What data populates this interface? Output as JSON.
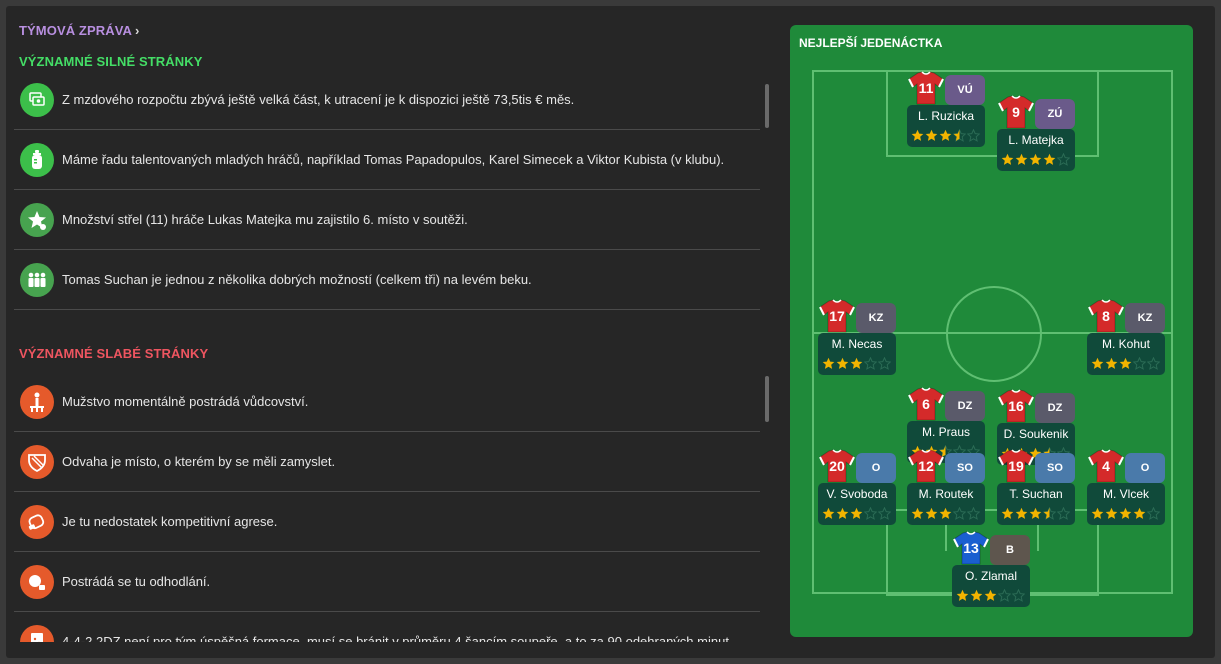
{
  "report": {
    "title": "TÝMOVÁ ZPRÁVA"
  },
  "strengths": {
    "title": "VÝZNAMNÉ SILNÉ STRÁNKY",
    "items": [
      {
        "icon": "money-icon",
        "text": "Z mzdového rozpočtu zbývá ještě velká část, k utracení je k dispozici ještě 73,5tis € měs."
      },
      {
        "icon": "baby-bottle-icon",
        "text": "Máme řadu talentovaných mladých hráčů, například Tomas Papadopulos, Karel Simecek a Viktor Kubista (v klubu)."
      },
      {
        "icon": "star-player-icon",
        "text": "Množství střel (11) hráče Lukas Matejka mu zajistilo 6. místo v soutěži."
      },
      {
        "icon": "squad-icon",
        "text": "Tomas Suchan je jednou z několika dobrých možností (celkem tři) na levém beku."
      }
    ]
  },
  "weaknesses": {
    "title": "VÝZNAMNÉ SLABÉ STRÁNKY",
    "items": [
      {
        "icon": "leader-icon",
        "text": "Mužstvo momentálně postrádá vůdcovství."
      },
      {
        "icon": "courage-icon",
        "text": "Odvaha je místo, o kterém by se měli zamyslet."
      },
      {
        "icon": "boxing-glove-icon",
        "text": "Je tu nedostatek kompetitivní agrese."
      },
      {
        "icon": "determination-icon",
        "text": "Postrádá se tu odhodlání."
      },
      {
        "icon": "tactics-board-icon",
        "text": "4-4-2 2DZ není pro tým úspěšná formace, musí se bránit v průměru 4 šancím soupeře, a to za 90 odehraných minut."
      }
    ]
  },
  "best_eleven": {
    "title": "NEJLEPŠÍ JEDENÁCTKA",
    "colors": {
      "card": "#1f8a3a",
      "label": "#104a3a",
      "star": "#f2b400",
      "home_shirt": "#d42a2a",
      "gk_shirt": "#1a5fd0"
    },
    "players": [
      {
        "num": "11",
        "pos": "VÚ",
        "name": "L. Ruzicka",
        "rating": 3.5,
        "kit": "home"
      },
      {
        "num": "9",
        "pos": "ZÚ",
        "name": "L. Matejka",
        "rating": 4,
        "kit": "home"
      },
      {
        "num": "17",
        "pos": "KZ",
        "name": "M. Necas",
        "rating": 3,
        "kit": "home"
      },
      {
        "num": "8",
        "pos": "KZ",
        "name": "M. Kohut",
        "rating": 3,
        "kit": "home"
      },
      {
        "num": "6",
        "pos": "DZ",
        "name": "M. Praus",
        "rating": 2.5,
        "kit": "home"
      },
      {
        "num": "16",
        "pos": "DZ",
        "name": "D. Soukenik",
        "rating": 3.5,
        "kit": "home"
      },
      {
        "num": "20",
        "pos": "O",
        "name": "V. Svoboda",
        "rating": 3,
        "kit": "home"
      },
      {
        "num": "12",
        "pos": "SO",
        "name": "M. Routek",
        "rating": 3,
        "kit": "home"
      },
      {
        "num": "19",
        "pos": "SO",
        "name": "T. Suchan",
        "rating": 3.5,
        "kit": "home"
      },
      {
        "num": "4",
        "pos": "O",
        "name": "M. Vlcek",
        "rating": 4,
        "kit": "home"
      },
      {
        "num": "13",
        "pos": "B",
        "name": "O. Zlamal",
        "rating": 3,
        "kit": "gk"
      }
    ]
  }
}
